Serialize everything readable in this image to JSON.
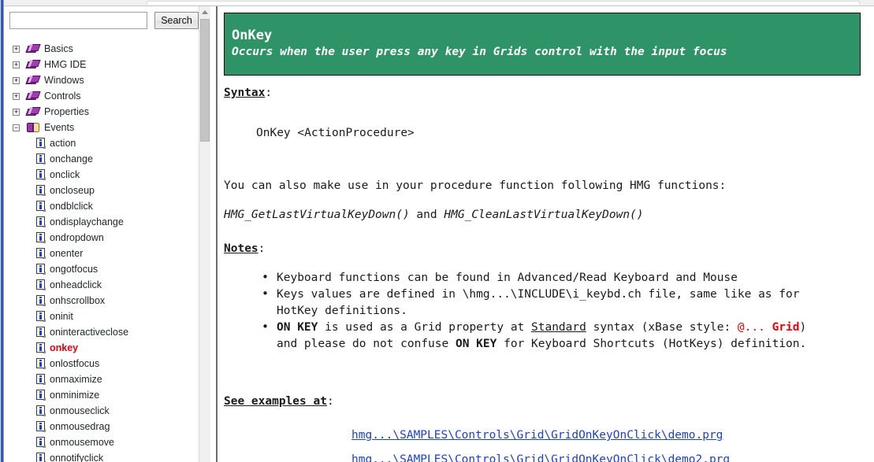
{
  "colors": {
    "banner_bg": "#2e9367",
    "link": "#1a3fd4",
    "selected": "#e8000b",
    "frame": "#2d4ba8"
  },
  "search": {
    "value": "",
    "placeholder": "",
    "button_label": "Search"
  },
  "tree": {
    "branches": [
      {
        "label": "Basics",
        "expander": "+",
        "icon": "book-icon"
      },
      {
        "label": "HMG IDE",
        "expander": "+",
        "icon": "book-icon"
      },
      {
        "label": "Windows",
        "expander": "+",
        "icon": "book-icon"
      },
      {
        "label": "Controls",
        "expander": "+",
        "icon": "book-icon"
      },
      {
        "label": "Properties",
        "expander": "+",
        "icon": "book-icon"
      },
      {
        "label": "Events",
        "expander": "−",
        "icon": "open-book-icon"
      }
    ],
    "leaves": [
      {
        "label": "action",
        "selected": false
      },
      {
        "label": "onchange",
        "selected": false
      },
      {
        "label": "onclick",
        "selected": false
      },
      {
        "label": "oncloseup",
        "selected": false
      },
      {
        "label": "ondblclick",
        "selected": false
      },
      {
        "label": "ondisplaychange",
        "selected": false
      },
      {
        "label": "ondropdown",
        "selected": false
      },
      {
        "label": "onenter",
        "selected": false
      },
      {
        "label": "ongotfocus",
        "selected": false
      },
      {
        "label": "onheadclick",
        "selected": false
      },
      {
        "label": "onhscrollbox",
        "selected": false
      },
      {
        "label": "oninit",
        "selected": false
      },
      {
        "label": "oninteractiveclose",
        "selected": false
      },
      {
        "label": "onkey",
        "selected": true
      },
      {
        "label": "onlostfocus",
        "selected": false
      },
      {
        "label": "onmaximize",
        "selected": false
      },
      {
        "label": "onminimize",
        "selected": false
      },
      {
        "label": "onmouseclick",
        "selected": false
      },
      {
        "label": "onmousedrag",
        "selected": false
      },
      {
        "label": "onmousemove",
        "selected": false
      },
      {
        "label": "onnotifyclick",
        "selected": false
      }
    ]
  },
  "banner": {
    "title": "OnKey",
    "subtitle": "Occurs when the user press any key in Grids control with the input focus"
  },
  "doc": {
    "syntax_heading": "Syntax",
    "syntax_colon": ":",
    "syntax_code": "OnKey <ActionProcedure>",
    "intro": "You can also make use in your procedure function following HMG functions:",
    "func1": "HMG_GetLastVirtualKeyDown()",
    "func_and": " and ",
    "func2": "HMG_CleanLastVirtualKeyDown()",
    "notes_heading": "Notes",
    "notes_colon": ":",
    "note1": "Keyboard functions can be found in Advanced/Read Keyboard and Mouse",
    "note2_a": "Keys values are defined in \\hmg...\\INCLUDE\\i_keybd.ch file, same like as for",
    "note2_b": "HotKey definitions.",
    "note3_onkey": "ON KEY",
    "note3_a": " is used as a Grid property at ",
    "note3_standard": "Standard",
    "note3_b": " syntax (xBase style: ",
    "note3_at": "@... ",
    "note3_grid": "Grid",
    "note3_c": ")",
    "note3_d": "and please do not confuse ",
    "note3_onkey2": "ON KEY",
    "note3_e": " for Keyboard Shortcuts (HotKeys) definition.",
    "see_heading": "See examples at",
    "see_colon": ":",
    "link1": "hmg...\\SAMPLES\\Controls\\Grid\\GridOnKeyOnClick\\demo.prg",
    "link2": "hmg...\\SAMPLES\\Controls\\Grid\\GridOnKeyOnClick\\demo2.prg"
  }
}
